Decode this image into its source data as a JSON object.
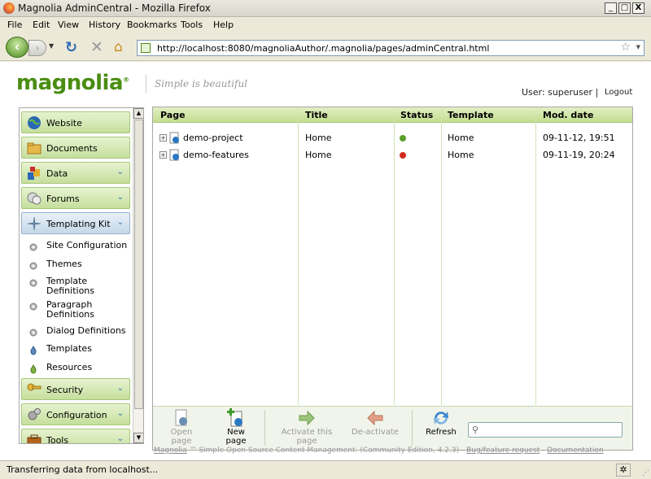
{
  "window": {
    "title": "Magnolia AdminCentral - Mozilla Firefox",
    "minimize": "_",
    "maximize": "□",
    "close": "X"
  },
  "menu": [
    "File",
    "Edit",
    "View",
    "History",
    "Bookmarks",
    "Tools",
    "Help"
  ],
  "browser": {
    "url": "http://localhost:8080/magnoliaAuthor/.magnolia/pages/adminCentral.html",
    "status": "Transferring data from localhost..."
  },
  "header": {
    "logo": "magnolia",
    "logo_mark": "®",
    "tagline": "Simple is beautiful",
    "user_label": "User: superuser |",
    "logout": "Logout"
  },
  "sidebar": {
    "items": [
      {
        "label": "Website",
        "icon": "globe-icon"
      },
      {
        "label": "Documents",
        "icon": "folder-icon"
      },
      {
        "label": "Data",
        "icon": "data-icon",
        "expandable": true
      },
      {
        "label": "Forums",
        "icon": "forums-icon",
        "expandable": true
      },
      {
        "label": "Templating Kit",
        "icon": "templating-kit-icon",
        "expandable": true,
        "expanded": true
      },
      {
        "label": "Security",
        "icon": "key-icon",
        "expandable": true
      },
      {
        "label": "Configuration",
        "icon": "gears-icon",
        "expandable": true
      },
      {
        "label": "Tools",
        "icon": "toolbox-icon",
        "expandable": true
      }
    ],
    "subitems": [
      {
        "label": "Site Configuration"
      },
      {
        "label": "Themes"
      },
      {
        "label": "Template Definitions"
      },
      {
        "label": "Paragraph Definitions"
      },
      {
        "label": "Dialog Definitions"
      },
      {
        "label": "Templates"
      },
      {
        "label": "Resources"
      }
    ]
  },
  "table": {
    "columns": [
      "Page",
      "Title",
      "Status",
      "Template",
      "Mod. date"
    ],
    "rows": [
      {
        "page": "demo-project",
        "title": "Home",
        "status": "activated",
        "status_color": "#5aa02c",
        "template": "Home",
        "mod_date": "09-11-12, 19:51"
      },
      {
        "page": "demo-features",
        "title": "Home",
        "status": "modified",
        "status_color": "#d22a1e",
        "template": "Home",
        "mod_date": "09-11-19, 20:24"
      }
    ]
  },
  "toolbar": {
    "open_page": "Open page",
    "new_page": "New page",
    "activate": "Activate this page",
    "deactivate": "De-activate",
    "refresh": "Refresh"
  },
  "footer": {
    "magnolia_link": "Magnolia",
    "text": " ™ Simple Open Source Content Management. (Community Edition, 4.2.3) - ",
    "bug_link": "Bug/feature request",
    "sep": " - ",
    "doc_link": "Documentation"
  }
}
